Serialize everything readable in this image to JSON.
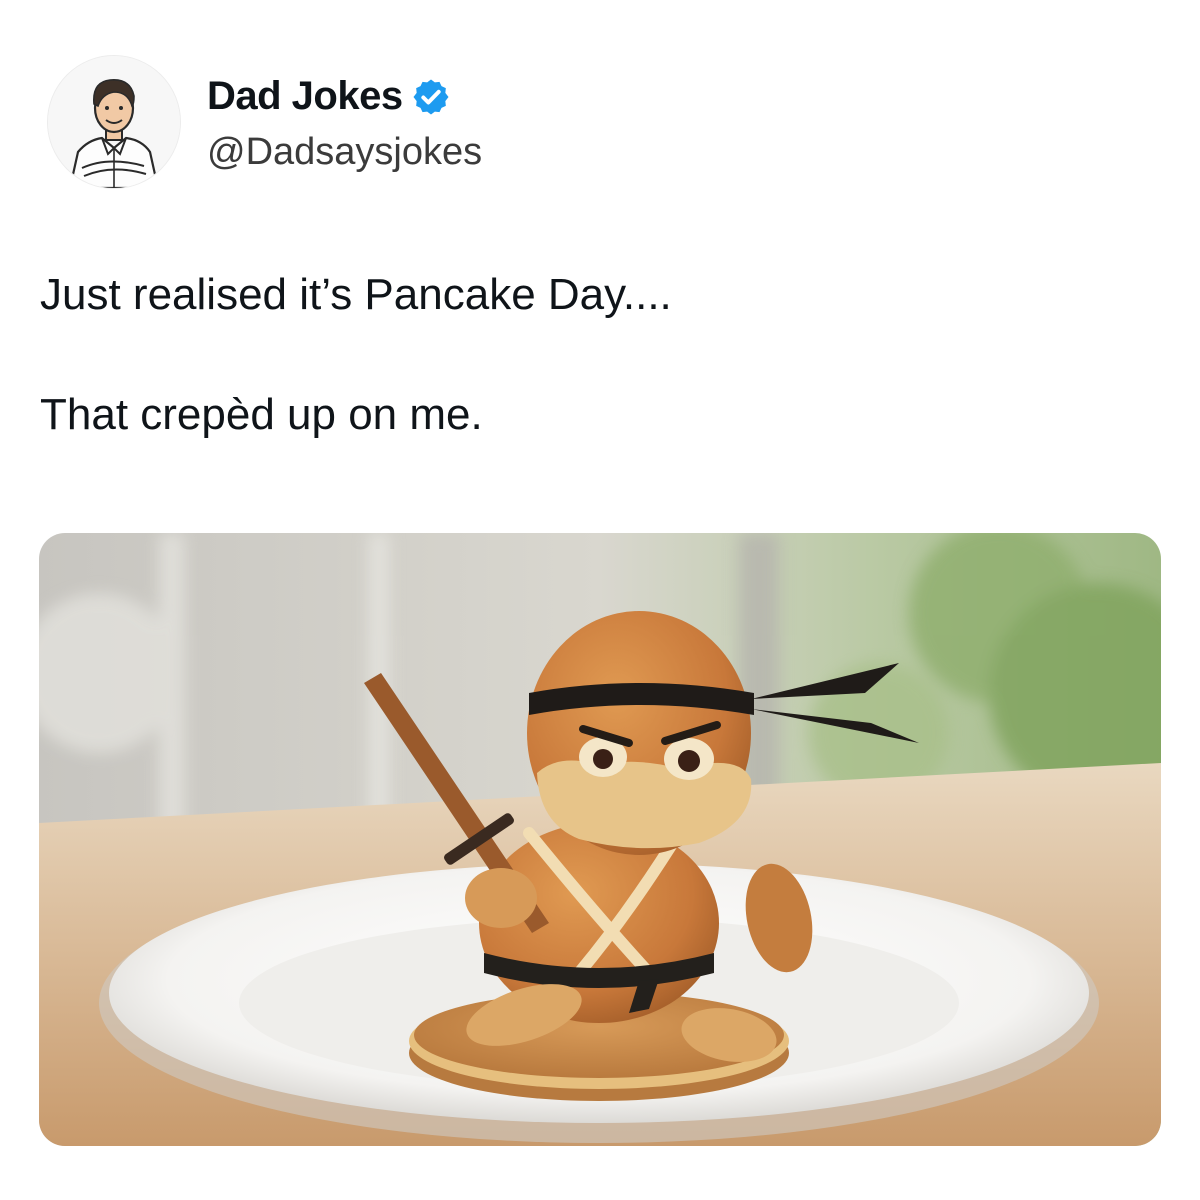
{
  "author": {
    "display_name": "Dad Jokes",
    "handle": "@Dadsaysjokes",
    "verified": true,
    "verified_color": "#1d9bf0",
    "avatar_icon": "cartoon-man-avatar"
  },
  "tweet": {
    "lines": [
      "Just realised it’s Pancake Day....",
      "That crepèd up on me."
    ]
  },
  "media": {
    "icon": "ninja-pancake-photo"
  }
}
